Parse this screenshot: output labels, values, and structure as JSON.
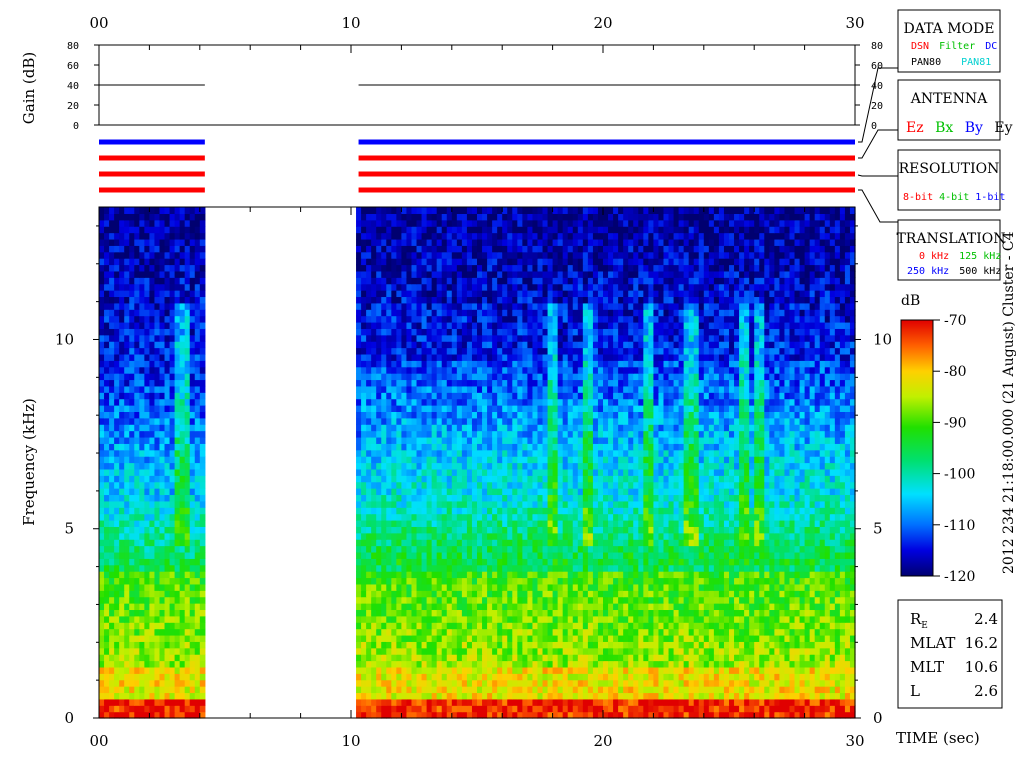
{
  "chart_data": {
    "type": "heatmap",
    "xlabel": "TIME (sec)",
    "ylabel": "Frequency (kHz)",
    "xlim": [
      0,
      30
    ],
    "ylim": [
      0,
      13.5
    ],
    "x_ticks": [
      "00",
      "10",
      "20",
      "30"
    ],
    "y_ticks": [
      "0",
      "5",
      "10"
    ],
    "data_gap_sec": [
      4.2,
      10.3
    ],
    "gain": {
      "label": "Gain (dB)",
      "ylim": [
        0,
        80
      ],
      "ticks": [
        "0",
        "20",
        "40",
        "60",
        "80"
      ],
      "segments": [
        {
          "x": [
            0,
            4.2
          ],
          "value": 40
        },
        {
          "x": [
            10.3,
            30
          ],
          "value": 40
        }
      ]
    },
    "status_bars": [
      {
        "row": 1,
        "color": "#0000ff"
      },
      {
        "row": 2,
        "color": "#ff0000"
      },
      {
        "row": 3,
        "color": "#ff0000"
      },
      {
        "row": 4,
        "color": "#ff0000"
      }
    ],
    "colorbar": {
      "unit": "dB",
      "min": -120,
      "max": -70,
      "ticks": [
        "-70",
        "-80",
        "-90",
        "-100",
        "-110",
        "-120"
      ]
    },
    "side_title": "2012 234 21:18:00.000 (21 August)   Cluster - C4",
    "legend": {
      "data_mode": {
        "title": "DATA MODE",
        "row1": [
          {
            "text": "DSN",
            "color": "#ff0000"
          },
          {
            "text": "Filter",
            "color": "#00c000"
          },
          {
            "text": "DC",
            "color": "#0000ff"
          }
        ],
        "row2": [
          {
            "text": "PAN80",
            "color": "#000000"
          },
          {
            "text": "PAN81",
            "color": "#00d0d0"
          }
        ]
      },
      "antenna": {
        "title": "ANTENNA",
        "items": [
          {
            "text": "Ez",
            "color": "#ff0000"
          },
          {
            "text": "Bx",
            "color": "#00c000"
          },
          {
            "text": "By",
            "color": "#0000ff"
          },
          {
            "text": "Ey",
            "color": "#000000"
          }
        ]
      },
      "resolution": {
        "title": "RESOLUTION",
        "items": [
          {
            "text": "8-bit",
            "color": "#ff0000"
          },
          {
            "text": "4-bit",
            "color": "#00c000"
          },
          {
            "text": "1-bit",
            "color": "#0000ff"
          }
        ]
      },
      "translation": {
        "title": "TRANSLATION",
        "row1": [
          {
            "text": "0 kHz",
            "color": "#ff0000"
          },
          {
            "text": "125 kHz",
            "color": "#00c000"
          }
        ],
        "row2": [
          {
            "text": "250 kHz",
            "color": "#0000ff"
          },
          {
            "text": "500 kHz",
            "color": "#000000"
          }
        ]
      }
    },
    "orbit_params": [
      {
        "label": "R",
        "sub": "E",
        "value": "2.4"
      },
      {
        "label": "MLAT",
        "sub": "",
        "value": "16.2"
      },
      {
        "label": "MLT",
        "sub": "",
        "value": "10.6"
      },
      {
        "label": "L",
        "sub": "",
        "value": "2.6"
      }
    ]
  }
}
